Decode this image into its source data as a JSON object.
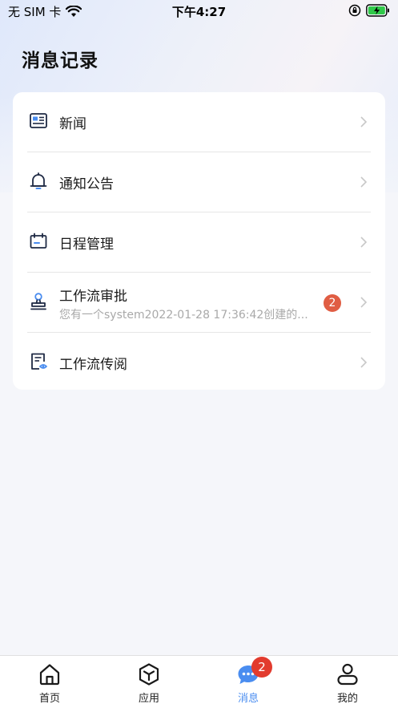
{
  "status_bar": {
    "carrier": "无 SIM 卡",
    "time": "下午4:27"
  },
  "header": {
    "title": "消息记录"
  },
  "messages": [
    {
      "title": "新闻",
      "icon": "news-icon"
    },
    {
      "title": "通知公告",
      "icon": "bell-icon"
    },
    {
      "title": "日程管理",
      "icon": "calendar-icon"
    },
    {
      "title": "工作流审批",
      "subtitle": "您有一个system2022-01-28 17:36:42创建的...",
      "badge": "2",
      "icon": "approval-stamp-icon"
    },
    {
      "title": "工作流传阅",
      "icon": "document-view-icon"
    }
  ],
  "tab_bar": {
    "tabs": [
      {
        "label": "首页",
        "icon": "home-icon"
      },
      {
        "label": "应用",
        "icon": "cube-icon"
      },
      {
        "label": "消息",
        "icon": "chat-icon",
        "active": true,
        "badge": "2"
      },
      {
        "label": "我的",
        "icon": "user-icon"
      }
    ]
  },
  "colors": {
    "accent": "#4a8df0",
    "badge_red": "#e23b2e",
    "badge_orange": "#e05d43",
    "icon_dark": "#1f2a44"
  }
}
